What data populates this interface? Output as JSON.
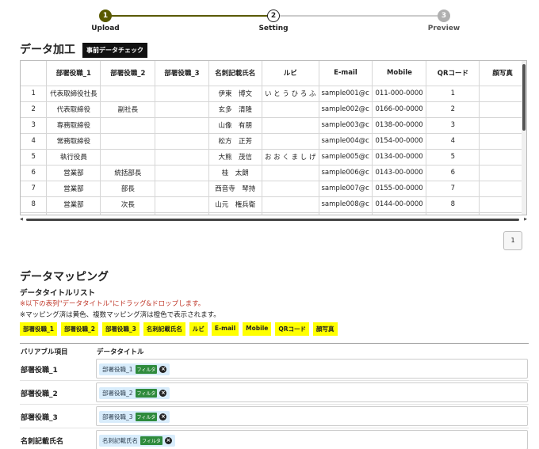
{
  "stepper": {
    "steps": [
      {
        "num": "1",
        "label": "Upload"
      },
      {
        "num": "2",
        "label": "Setting"
      },
      {
        "num": "3",
        "label": "Preview"
      }
    ],
    "colors": {
      "done": "#5a5a00",
      "current": "#222222",
      "pending": "#b0b0b0"
    }
  },
  "data_section": {
    "title": "データ加工",
    "precheck_button": "事前データチェック"
  },
  "table": {
    "columns": [
      "",
      "部署役職_1",
      "部署役職_2",
      "部署役職_3",
      "名刺記載氏名",
      "ルビ",
      "E-mail",
      "Mobile",
      "QRコード",
      "顔写真"
    ],
    "rows": [
      [
        "1",
        "代表取締役社長",
        "",
        "",
        "伊東　博文",
        "い と う ひ ろ ふ",
        "sample001@c",
        "011-000-0000",
        "1",
        ""
      ],
      [
        "2",
        "代表取締役",
        "副社長",
        "",
        "玄多　清隆",
        "",
        "sample002@c",
        "0166-00-0000",
        "2",
        ""
      ],
      [
        "3",
        "専務取締役",
        "",
        "",
        "山像　有朋",
        "",
        "sample003@c",
        "0138-00-0000",
        "3",
        ""
      ],
      [
        "4",
        "常務取締役",
        "",
        "",
        "松方　正芳",
        "",
        "sample004@c",
        "0154-00-0000",
        "4",
        ""
      ],
      [
        "5",
        "執行役員",
        "",
        "",
        "大熊　茂信",
        "お お く ま し げ",
        "sample005@c",
        "0134-00-0000",
        "5",
        ""
      ],
      [
        "6",
        "営業部",
        "統括部長",
        "",
        "桂　太朗",
        "",
        "sample006@c",
        "0143-00-0000",
        "6",
        ""
      ],
      [
        "7",
        "営業部",
        "部長",
        "",
        "西音寺　琴持",
        "",
        "sample007@c",
        "0155-00-0000",
        "7",
        ""
      ],
      [
        "8",
        "営業部",
        "次長",
        "",
        "山元　権兵衛",
        "",
        "sample008@c",
        "0144-00-0000",
        "8",
        ""
      ]
    ]
  },
  "pagination": {
    "page": "1"
  },
  "mapping": {
    "title": "データマッピング",
    "list_title": "データタイトルリスト",
    "note_red": "※以下の表列\"データタイトル\"にドラッグ&ドロップします。",
    "note_black": "※マッピング済は黄色、複数マッピング済は橙色で表示されます。",
    "tags": [
      "部署役職_1",
      "部署役職_2",
      "部署役職_3",
      "名刺記載氏名",
      "ルビ",
      "E-mail",
      "Mobile",
      "QRコード",
      "顔写真"
    ],
    "header_var": "バリアブル項目",
    "header_title": "データタイトル",
    "filter_label": "フィルタ",
    "rows": [
      {
        "var": "部署役職_1",
        "chip": "部署役職_1"
      },
      {
        "var": "部署役職_2",
        "chip": "部署役職_2"
      },
      {
        "var": "部署役職_3",
        "chip": "部署役職_3"
      },
      {
        "var": "名刺記載氏名",
        "chip": "名刺記載氏名"
      }
    ]
  }
}
